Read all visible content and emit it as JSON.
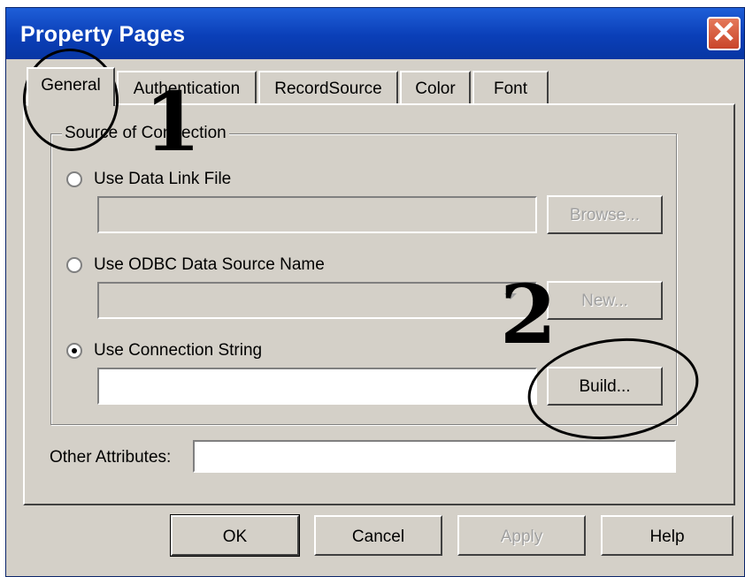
{
  "window": {
    "title": "Property Pages",
    "close_label": "✕"
  },
  "tabs": [
    {
      "label": "General",
      "active": true
    },
    {
      "label": "Authentication",
      "active": false
    },
    {
      "label": "RecordSource",
      "active": false
    },
    {
      "label": "Color",
      "active": false
    },
    {
      "label": "Font",
      "active": false
    }
  ],
  "group": {
    "label": "Source of Connection"
  },
  "options": {
    "data_link": {
      "label": "Use Data Link File",
      "selected": false,
      "browse_label": "Browse...",
      "value": ""
    },
    "odbc": {
      "label": "Use ODBC Data Source Name",
      "selected": false,
      "new_label": "New...",
      "value": ""
    },
    "connection_string": {
      "label": "Use Connection String",
      "selected": true,
      "build_label": "Build...",
      "value": ""
    }
  },
  "other_attributes": {
    "label": "Other Attributes:",
    "value": ""
  },
  "buttons": {
    "ok": "OK",
    "cancel": "Cancel",
    "apply": "Apply",
    "help": "Help"
  },
  "annotations": {
    "one": "1",
    "two": "2"
  },
  "colors": {
    "titlebar": "#0a3fb8",
    "face": "#d4d0c8",
    "close": "#c9452a"
  },
  "icons": {
    "close": "close-icon",
    "dropdown": "chevron-down-icon"
  }
}
